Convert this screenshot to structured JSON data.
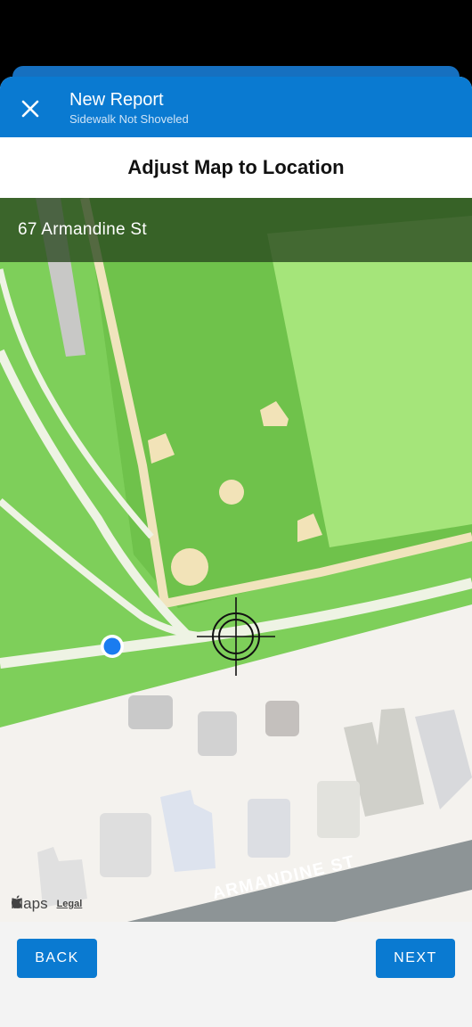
{
  "header": {
    "close_icon": "close-icon",
    "title": "New Report",
    "subtitle": "Sidewalk Not Shoveled"
  },
  "instruction": "Adjust Map to Location",
  "map": {
    "address": "67 Armandine St",
    "street_label": "ARMANDINE ST",
    "attribution": "Maps",
    "legal": "Legal",
    "crosshair_icon": "crosshair-icon",
    "location_dot": "current-location-dot",
    "colors": {
      "park": "#7ecf5a",
      "field": "#a5e57a",
      "path": "#eef3e4",
      "sand": "#f2e3b8",
      "street": "#8d9496",
      "ground": "#f4f2ee",
      "building": "#dcdcdc",
      "location_dot": "#1a7cf0"
    }
  },
  "fab": {
    "icon": "more-vertical-icon"
  },
  "footer": {
    "back_label": "BACK",
    "next_label": "NEXT"
  },
  "colors": {
    "accent": "#0a7ad1",
    "fab": "#12304f"
  }
}
